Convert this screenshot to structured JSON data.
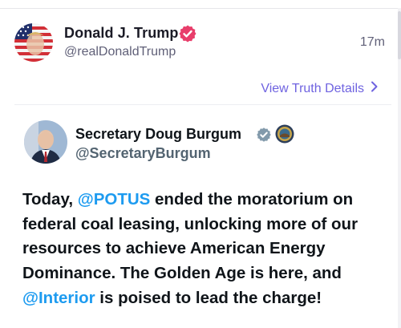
{
  "post": {
    "author_name": "Donald J. Trump",
    "author_handle": "@realDonaldTrump",
    "timestamp": "17m",
    "view_details_label": "View Truth Details"
  },
  "embedded_tweet": {
    "name": "Secretary Doug Burgum",
    "handle": "@SecretaryBurgum",
    "text_parts": {
      "p1": "Today, ",
      "m1": "@POTUS",
      "p2": " ended the moratorium on federal coal leasing, unlocking more of our resources to achieve American Energy Dominance. The Golden Age is here, and ",
      "m2": "@Interior",
      "p3": " is poised to lead the charge!"
    }
  },
  "colors": {
    "link_purple": "#6f63e0",
    "mention_blue": "#1d9bf0",
    "verified_pink": "#e83e6b",
    "verified_grey": "#829aab"
  },
  "icons": {
    "verified_main": "verified-badge-icon",
    "verified_embed": "verified-check-icon",
    "seal": "department-seal-icon",
    "chevron": "chevron-right-icon"
  }
}
